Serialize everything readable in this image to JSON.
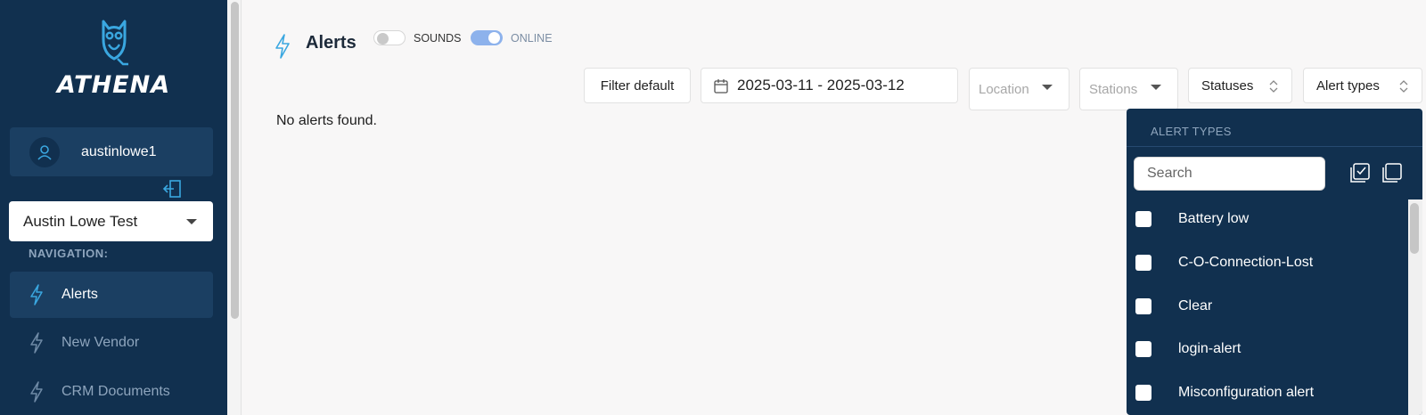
{
  "brand": {
    "name": "ATHENA"
  },
  "user": {
    "name": "austinlowe1"
  },
  "account": {
    "selected": "Austin Lowe Test"
  },
  "nav": {
    "heading": "NAVIGATION:",
    "items": [
      {
        "label": "Alerts",
        "icon": "lightning-icon",
        "active": true
      },
      {
        "label": "New Vendor",
        "icon": "lightning-icon",
        "active": false
      },
      {
        "label": "CRM Documents",
        "icon": "lightning-icon",
        "active": false
      }
    ]
  },
  "header": {
    "title": "Alerts",
    "sounds_label": "SOUNDS",
    "sounds_on": false,
    "online_label": "ONLINE",
    "online_on": true
  },
  "filters": {
    "filter_default_label": "Filter default",
    "date_range": "2025-03-11 - 2025-03-12",
    "location_placeholder": "Location",
    "stations_placeholder": "Stations",
    "statuses_label": "Statuses",
    "alert_types_label": "Alert types"
  },
  "main": {
    "empty_message": "No alerts found."
  },
  "alert_types_panel": {
    "title": "ALERT TYPES",
    "search_placeholder": "Search",
    "options": [
      {
        "label": "Battery low",
        "checked": false
      },
      {
        "label": "C-O-Connection-Lost",
        "checked": false
      },
      {
        "label": "Clear",
        "checked": false
      },
      {
        "label": "login-alert",
        "checked": false
      },
      {
        "label": "Misconfiguration alert",
        "checked": false
      }
    ]
  },
  "colors": {
    "sidebar_bg": "#11304f",
    "sidebar_active": "#1b3f62",
    "accent_blue": "#3aa7e0",
    "toggle_on": "#8db2ec"
  }
}
